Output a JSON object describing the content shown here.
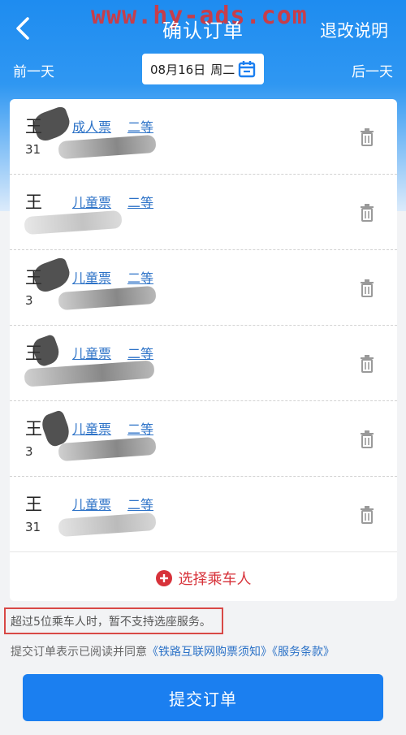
{
  "watermark": "www.hy-ads.com",
  "header": {
    "title": "确认订单",
    "refund_label": "退改说明"
  },
  "date_bar": {
    "prev_label": "前一天",
    "next_label": "后一天",
    "date": "08月16日",
    "weekday": "周二"
  },
  "passengers": [
    {
      "name": "王",
      "ticket_type": "成人票",
      "seat_class": "二等",
      "id_partial": "31"
    },
    {
      "name": "王",
      "ticket_type": "儿童票",
      "seat_class": "二等",
      "id_partial": ""
    },
    {
      "name": "王",
      "ticket_type": "儿童票",
      "seat_class": "二等",
      "id_partial": "3"
    },
    {
      "name": "王",
      "ticket_type": "儿童票",
      "seat_class": "二等",
      "id_partial": ""
    },
    {
      "name": "王",
      "ticket_type": "儿童票",
      "seat_class": "二等",
      "id_partial": "3"
    },
    {
      "name": "王",
      "ticket_type": "儿童票",
      "seat_class": "二等",
      "id_partial": "31"
    }
  ],
  "add_passenger_label": "选择乘车人",
  "notice": "超过5位乘车人时，暂不支持选座服务。",
  "agreement": {
    "prefix": "提交订单表示已阅读并同意",
    "link1": "《铁路互联网购票须知》",
    "link2": "《服务条款》"
  },
  "submit_label": "提交订单",
  "colors": {
    "primary": "#1b7ff0",
    "link": "#2c72c7",
    "danger": "#d7323a"
  }
}
